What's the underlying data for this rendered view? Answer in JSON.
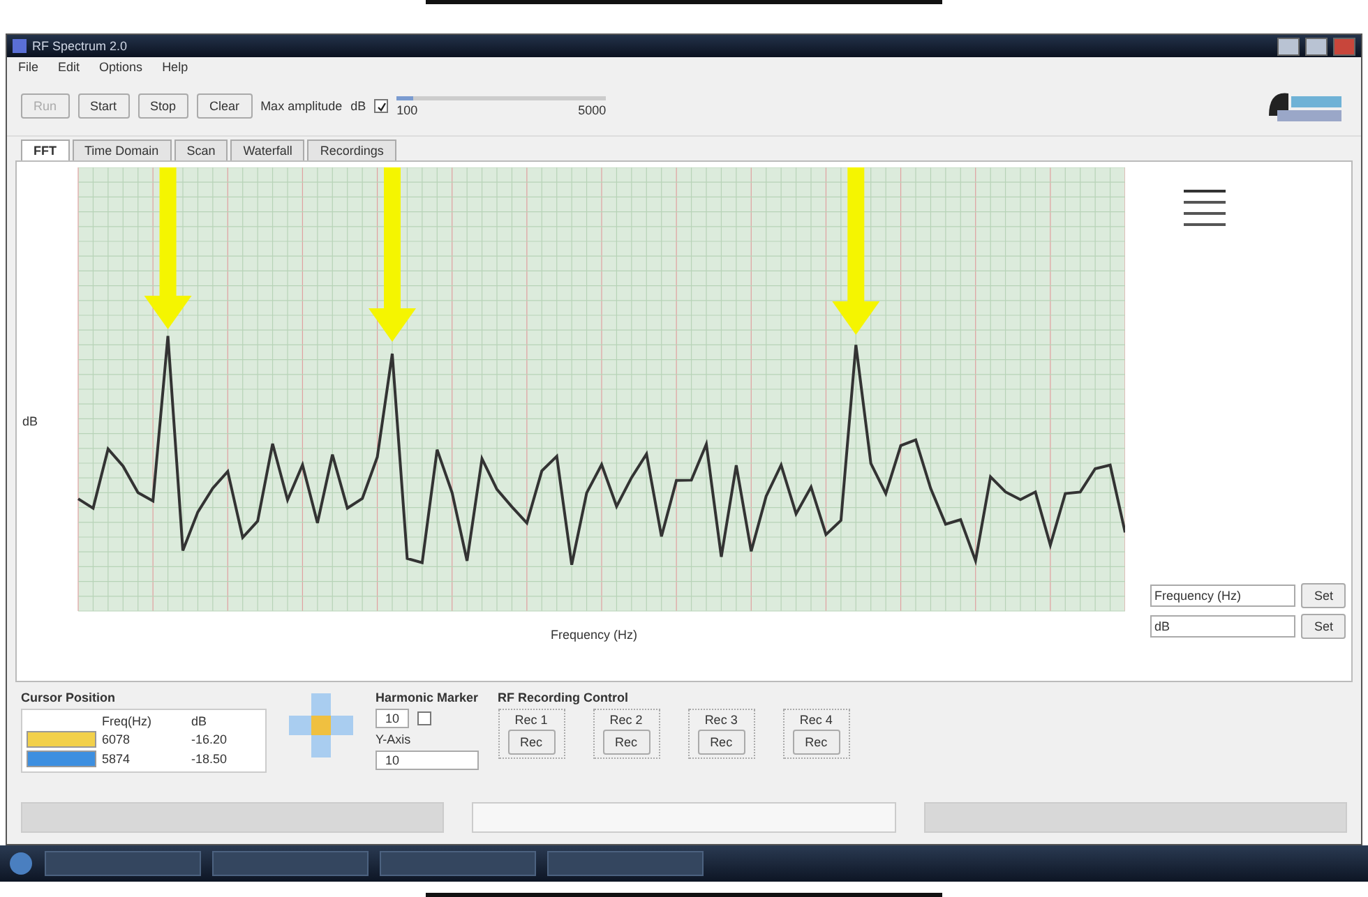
{
  "window": {
    "title": "RF Spectrum 2.0"
  },
  "menu": [
    "File",
    "Edit",
    "Options",
    "Help"
  ],
  "toolbar": {
    "buttons": [
      {
        "label": "Run",
        "disabled": true
      },
      {
        "label": "Start",
        "disabled": false
      },
      {
        "label": "Stop",
        "disabled": false
      },
      {
        "label": "Clear",
        "disabled": false
      }
    ],
    "caption": "Max amplitude",
    "unit": "dB",
    "checked": true,
    "slider": {
      "level": 0.08,
      "min": "100",
      "max": "5000"
    }
  },
  "tabs": [
    {
      "label": "FFT",
      "selected": true
    },
    {
      "label": "Time Domain",
      "selected": false
    },
    {
      "label": "Scan",
      "selected": false
    },
    {
      "label": "Waterfall",
      "selected": false
    },
    {
      "label": "Recordings",
      "selected": false
    }
  ],
  "chart": {
    "ylabel": "dB",
    "xlabel": "Frequency (Hz)"
  },
  "legend": [
    {
      "color": "#333333"
    },
    {
      "color": "#555555"
    },
    {
      "color": "#555555"
    },
    {
      "color": "#555555"
    }
  ],
  "side_fields": [
    {
      "value": "Frequency (Hz)",
      "button": "Set"
    },
    {
      "value": "dB",
      "button": "Set"
    }
  ],
  "cursor": {
    "title": "Cursor Position",
    "columns": [
      "Freq(Hz)",
      "dB"
    ],
    "rows": [
      {
        "color": "#f2d04a",
        "cells": [
          "6078",
          "-16.20"
        ]
      },
      {
        "color": "#3d8fe0",
        "cells": [
          "5874",
          "-18.50"
        ]
      }
    ]
  },
  "harmonic": {
    "title": "Harmonic Marker",
    "value": "10",
    "checked": false,
    "axis_label": "Y-Axis",
    "axis_value": "10"
  },
  "recording": {
    "title": "RF Recording Control",
    "groups": [
      {
        "label": "Rec 1",
        "button": "Rec"
      },
      {
        "label": "Rec 2",
        "button": "Rec"
      },
      {
        "label": "Rec 3",
        "button": "Rec"
      },
      {
        "label": "Rec 4",
        "button": "Rec"
      }
    ]
  }
}
